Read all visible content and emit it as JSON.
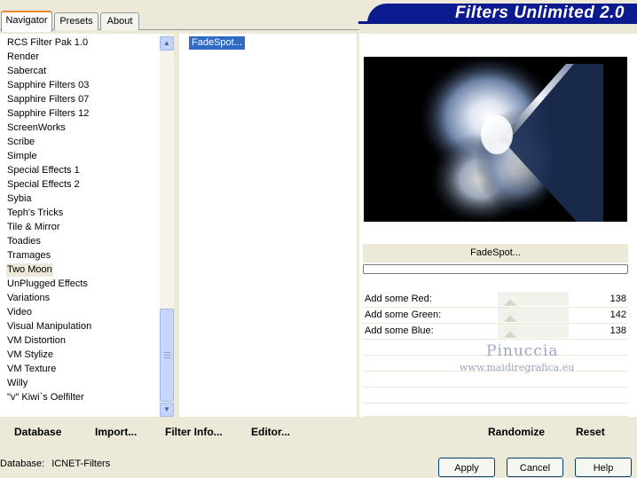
{
  "tabs": [
    {
      "label": "Navigator"
    },
    {
      "label": "Presets"
    },
    {
      "label": "About"
    }
  ],
  "banner": {
    "title": "Filters Unlimited 2.0"
  },
  "categories": [
    "RCS Filter Pak 1.0",
    "Render",
    "Sabercat",
    "Sapphire Filters 03",
    "Sapphire Filters 07",
    "Sapphire Filters 12",
    "ScreenWorks",
    "Scribe",
    "Simple",
    "Special Effects 1",
    "Special Effects 2",
    "Sybia",
    "Teph's Tricks",
    "Tile & Mirror",
    "Toadies",
    "Tramages",
    "Two Moon",
    "UnPlugged Effects",
    "Variations",
    "Video",
    "Visual Manipulation",
    "VM Distortion",
    "VM Stylize",
    "VM Texture",
    "Willy",
    "\"v\" Kiwi`s Oelfilter"
  ],
  "selected_category": "Two Moon",
  "filters": [
    "FadeSpot..."
  ],
  "selected_filter_name": "FadeSpot...",
  "sliders": [
    {
      "label": "Add some Red:",
      "value": "138"
    },
    {
      "label": "Add some Green:",
      "value": "142"
    },
    {
      "label": "Add some Blue:",
      "value": "138"
    }
  ],
  "watermark": {
    "name": "Pinuccia",
    "url": "www.maidiregrafica.eu"
  },
  "bottom_buttons": {
    "database": "Database",
    "import": "Import...",
    "filter_info": "Filter Info...",
    "editor": "Editor...",
    "randomize": "Randomize",
    "reset": "Reset"
  },
  "status": {
    "label": "Database:",
    "value": "ICNET-Filters"
  },
  "dialog_buttons": {
    "apply": "Apply",
    "cancel": "Cancel",
    "help": "Help"
  },
  "colors": {
    "banner": "#0b1a8f",
    "selection": "#316ac5",
    "tab_accent": "#e68b2c"
  },
  "icons": {
    "scroll_up": "scroll-up-arrow",
    "scroll_down": "scroll-down-arrow"
  }
}
